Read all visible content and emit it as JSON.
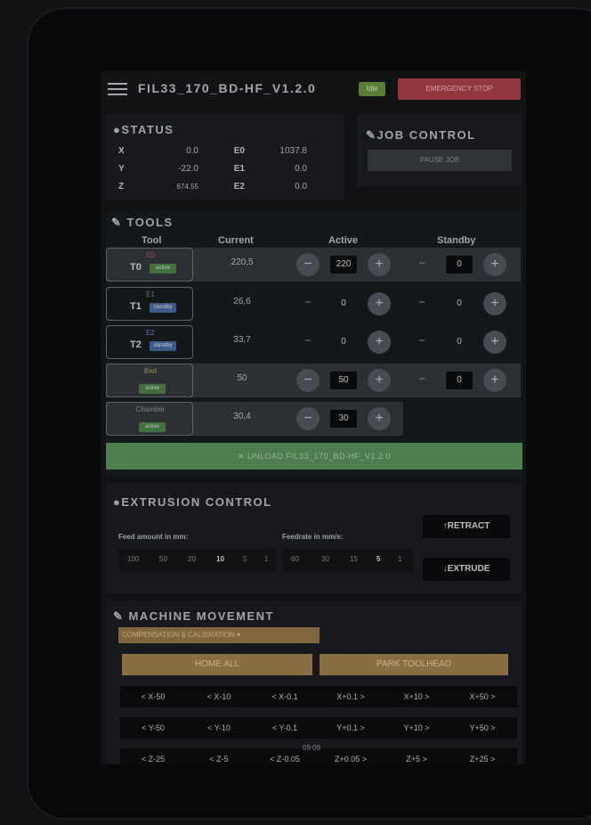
{
  "topbar": {
    "title": "FIL33_170_BD-HF_V1.2.0",
    "status_badge": "Idle",
    "estop_label": "EMERGENCY STOP"
  },
  "status": {
    "title": "STATUS",
    "rows": [
      {
        "axis": "X",
        "value": "0.0",
        "ext": "E0",
        "ext_value": "1037.8"
      },
      {
        "axis": "Y",
        "value": "-22.0",
        "ext": "E1",
        "ext_value": "0.0"
      },
      {
        "axis": "Z",
        "value": "674.55",
        "ext": "E2",
        "ext_value": "0.0"
      }
    ]
  },
  "job_control": {
    "title": "JOB CONTROL",
    "pause_label": "PAUSE JOB"
  },
  "tools": {
    "title": "TOOLS",
    "headers": {
      "tool": "Tool",
      "current": "Current",
      "active": "Active",
      "standby": "Standby"
    },
    "rows": [
      {
        "small": "E0",
        "name": "T0",
        "badge": "active",
        "badge_color": "#4f8a4a",
        "current": "220,5",
        "active": "220",
        "standby": "0"
      },
      {
        "small": "E1",
        "name": "T1",
        "badge": "standby",
        "badge_color": "#4a6fa5",
        "current": "26,6",
        "active": "0",
        "standby": "0"
      },
      {
        "small": "E2",
        "name": "T2",
        "badge": "standby",
        "badge_color": "#4a6fa5",
        "current": "33,7",
        "active": "0",
        "standby": "0"
      },
      {
        "small": "Bed",
        "name": "",
        "badge": "active",
        "badge_color": "#4f8a4a",
        "current": "50",
        "active": "50",
        "standby": "0"
      },
      {
        "small": "Chamber",
        "name": "",
        "badge": "active",
        "badge_color": "#4f8a4a",
        "current": "30,4",
        "active": "30",
        "standby": ""
      }
    ],
    "unload_label": "UNLOAD FIL33_170_BD-HF_V1.2.0"
  },
  "extrusion": {
    "title": "EXTRUSION CONTROL",
    "feed_label": "Feed amount in mm:",
    "feedrate_label": "Feedrate in mm/s:",
    "feed_amounts": [
      "100",
      "50",
      "20",
      "10",
      "5",
      "1"
    ],
    "feed_selected": "10",
    "feedrates": [
      "60",
      "30",
      "15",
      "5",
      "1"
    ],
    "feedrate_selected": "5",
    "retract_label": "RETRACT",
    "extrude_label": "EXTRUDE"
  },
  "movement": {
    "title": "MACHINE MOVEMENT",
    "compensation_label": "COMPENSATION & CALIBRATION ▾",
    "home_all_label": "HOME ALL",
    "park_label": "PARK TOOLHEAD",
    "x_row": [
      "< X-50",
      "< X-10",
      "< X-0.1",
      "X+0.1 >",
      "X+10 >",
      "X+50 >"
    ],
    "y_row": [
      "< Y-50",
      "< Y-10",
      "< Y-0.1",
      "Y+0.1 >",
      "Y+10 >",
      "Y+50 >"
    ],
    "z_row": [
      "< Z-25",
      "< Z-5",
      "< Z-0.05",
      "Z+0.05 >",
      "Z+5 >",
      "Z+25 >"
    ]
  },
  "clock": "09:09"
}
